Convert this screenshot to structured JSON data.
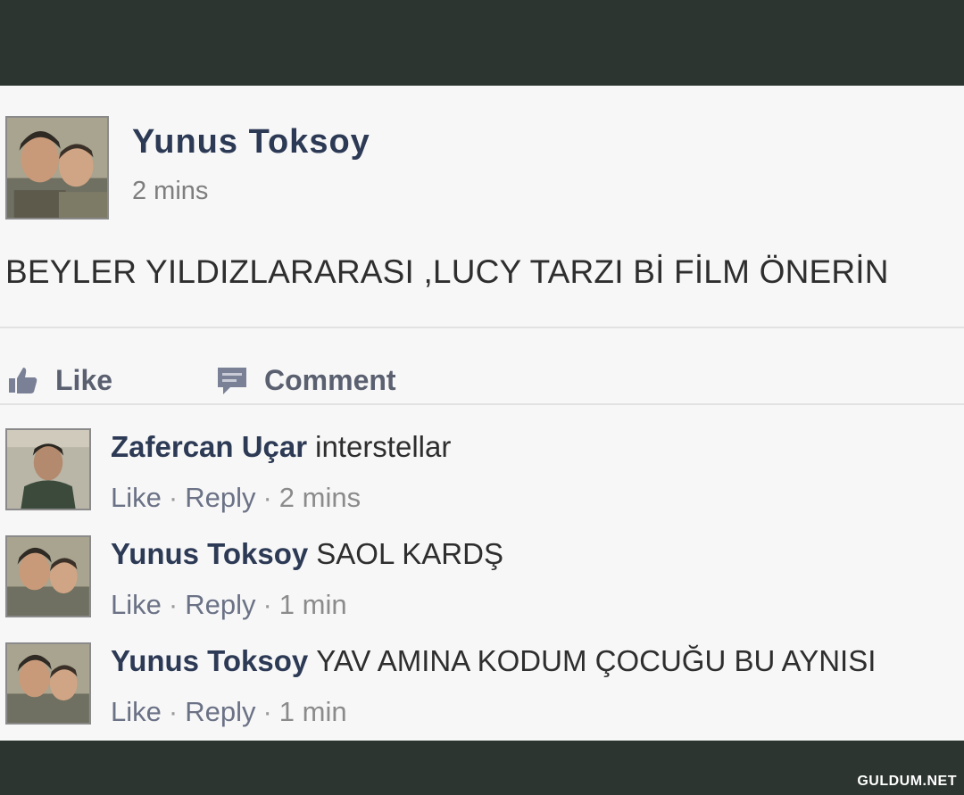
{
  "post": {
    "author": "Yunus Toksoy",
    "time": "2 mins",
    "body": "BEYLER YILDIZLARARASI ,LUCY TARZI Bİ FİLM ÖNERİN",
    "avatar_icon": "two-person-photo"
  },
  "actions": {
    "like_label": "Like",
    "like_icon": "thumbs-up-icon",
    "comment_label": "Comment",
    "comment_icon": "speech-bubble-icon"
  },
  "comments": [
    {
      "author": "Zafercan Uçar",
      "text": "interstellar",
      "like_label": "Like",
      "separator": "·",
      "reply_label": "Reply",
      "time": "2 mins"
    },
    {
      "author": "Yunus Toksoy",
      "text": "SAOL KARDŞ",
      "like_label": "Like",
      "separator": "·",
      "reply_label": "Reply",
      "time": "1 min"
    },
    {
      "author": "Yunus Toksoy",
      "text": "YAV AMINA KODUM ÇOCUĞU BU AYNISI",
      "like_label": "Like",
      "separator": "·",
      "reply_label": "Reply",
      "time": "1 min"
    }
  ],
  "watermark": "GULDUM.NET",
  "colors": {
    "frame": "#2c352f",
    "card": "#f7f7f7",
    "name": "#2d3a55",
    "muted": "#8b8b8b"
  }
}
